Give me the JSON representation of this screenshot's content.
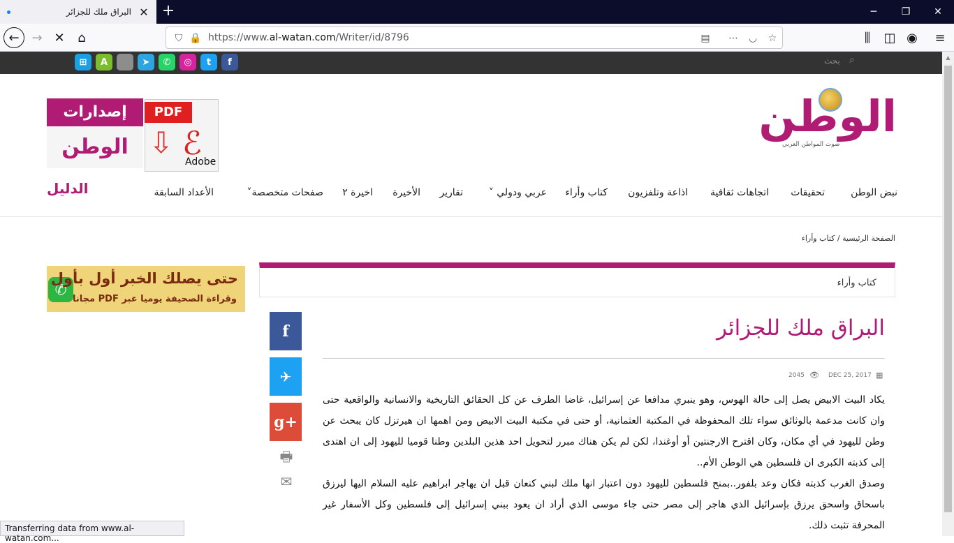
{
  "browser": {
    "tab_title": "البراق ملك للجزائر",
    "url_prefix": "https://www.",
    "url_domain": "al-watan.com",
    "url_path": "/Writer/id/8796",
    "status_text": "Transferring data from www.al-watan.com..."
  },
  "topstrip": {
    "search_label": "بحث",
    "social": [
      {
        "name": "windows",
        "glyph": "⊞",
        "color": "#1ba1e2"
      },
      {
        "name": "android",
        "glyph": "A",
        "color": "#7cbd2c"
      },
      {
        "name": "apple",
        "glyph": "",
        "color": "#8d8d8d"
      },
      {
        "name": "telegram",
        "glyph": "➤",
        "color": "#2ca5e0"
      },
      {
        "name": "whatsapp",
        "glyph": "✆",
        "color": "#25d366"
      },
      {
        "name": "instagram",
        "glyph": "◎",
        "color": "#d6249f"
      },
      {
        "name": "twitter",
        "glyph": "t",
        "color": "#1da1f2"
      },
      {
        "name": "facebook",
        "glyph": "f",
        "color": "#3b5998"
      }
    ]
  },
  "header": {
    "logo_text": "الوطن",
    "logo_sub": "صوت المواطن العربي",
    "issues_top": "إصدارات",
    "issues_bot": "الوطن",
    "pdf_tag": "PDF",
    "pdf_adobe": "Adobe",
    "daleel": "الدليل"
  },
  "nav": {
    "items": [
      "نبض الوطن",
      "تحقيقات",
      "اتجاهات ثقافية",
      "اذاعة وتلفزيون",
      "كتاب وأراء",
      "عربي ودولي",
      "تقارير",
      "الأخيرة",
      "اخيرة ٢",
      "صفحات متخصصة",
      "الأعداد السابقة"
    ]
  },
  "breadcrumb": {
    "home": "الصفحة الرئيسية",
    "separator": "/",
    "current": "كتاب وأراء"
  },
  "whatsapp_banner": {
    "line1": "حتى يصلك الخبر أول بأول",
    "line2": "وقراءة الصحيفة يوميا عبر PDF مجانا"
  },
  "section": {
    "title": "كتاب وأراء"
  },
  "share": {
    "facebook": "f",
    "twitter": "🐦",
    "googleplus": "g+",
    "print": "🖶",
    "email": "✉"
  },
  "article": {
    "title": "البراق ملك للجزائر",
    "date": "DEC 25, 2017",
    "views": "2045",
    "paragraphs": [
      "يكاد البيت الابيض يصل إلى حالة الهوس، وهو ينبري مدافعا عن إسرائيل، غاضا الطرف عن كل الحقائق التاريخية والانسانية والواقعية حتى وان كانت مدعمة بالوثائق سواء تلك المحفوظة في المكتبة العثمانية، أو حتى في مكتبة البيت الابيض ومن اهمها ان هيرتزل كان يبحث عن وطن لليهود في أي مكان، وكان اقترح الارجنتين أو أوغندا، لكن لم يكن هناك مبرر لتحويل احد هذين البلدين وطنا قوميا لليهود إلى ان اهتدى إلى كذبته الكبرى ان فلسطين هي الوطن الأم..",
      "وصدق الغرب كذبته فكان وعد بلفور..بمنح فلسطين لليهود دون اعتبار انها ملك لبني كنعان قبل ان يهاجر ابراهيم عليه السلام اليها ليرزق باسحاق واسحق يرزق بإسرائيل الذي هاجر إلى مصر حتى جاء موسى الذي أراد ان يعود ببني إسرائيل إلى فلسطين وكل الأسفار غير المحرفة تثبت ذلك."
    ]
  }
}
